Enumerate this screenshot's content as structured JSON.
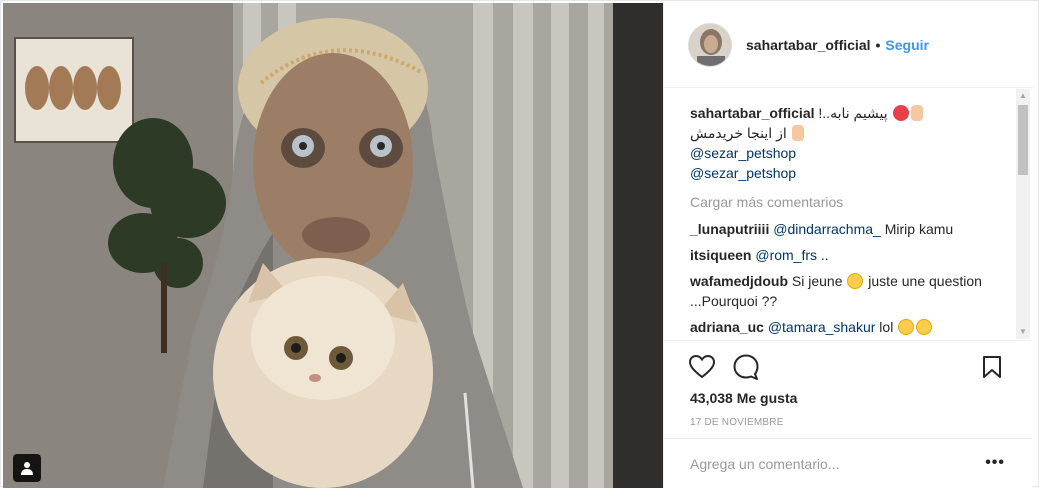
{
  "post": {
    "username": "sahartabar_official",
    "follow_label": "Seguir",
    "separator": "•",
    "caption": {
      "username": "sahartabar_official",
      "line1": "!..پیشیم نابه",
      "line2": "از اینجا خریدمش",
      "mentions": [
        "@sezar_petshop",
        "@sezar_petshop"
      ]
    },
    "load_more_label": "Cargar más comentarios",
    "comments": [
      {
        "user": "_lunaputriiii",
        "mention": "@dindarrachma_",
        "text": " Mirip kamu"
      },
      {
        "user": "itsiqueen",
        "mention": "@rom_frs",
        "text": " .."
      },
      {
        "user": "wafamedjdoub",
        "mention": "",
        "text": "Si jeune",
        "text2": " juste une question ...Pourquoi ??"
      },
      {
        "user": "adriana_uc",
        "mention": "@tamara_shakur",
        "text": " lol "
      }
    ],
    "likes_label": "43,038 Me gusta",
    "date_label": "17 DE NOVIEMBRE",
    "add_comment_placeholder": "Agrega un comentario...",
    "more_label": "•••"
  },
  "icons": {
    "heart": "heart-icon",
    "comment": "comment-icon",
    "bookmark": "bookmark-icon",
    "tag": "user-tag-icon"
  },
  "colors": {
    "link_blue": "#3897f0",
    "mention_blue": "#003569",
    "muted_gray": "#999999",
    "border": "#efefef"
  }
}
